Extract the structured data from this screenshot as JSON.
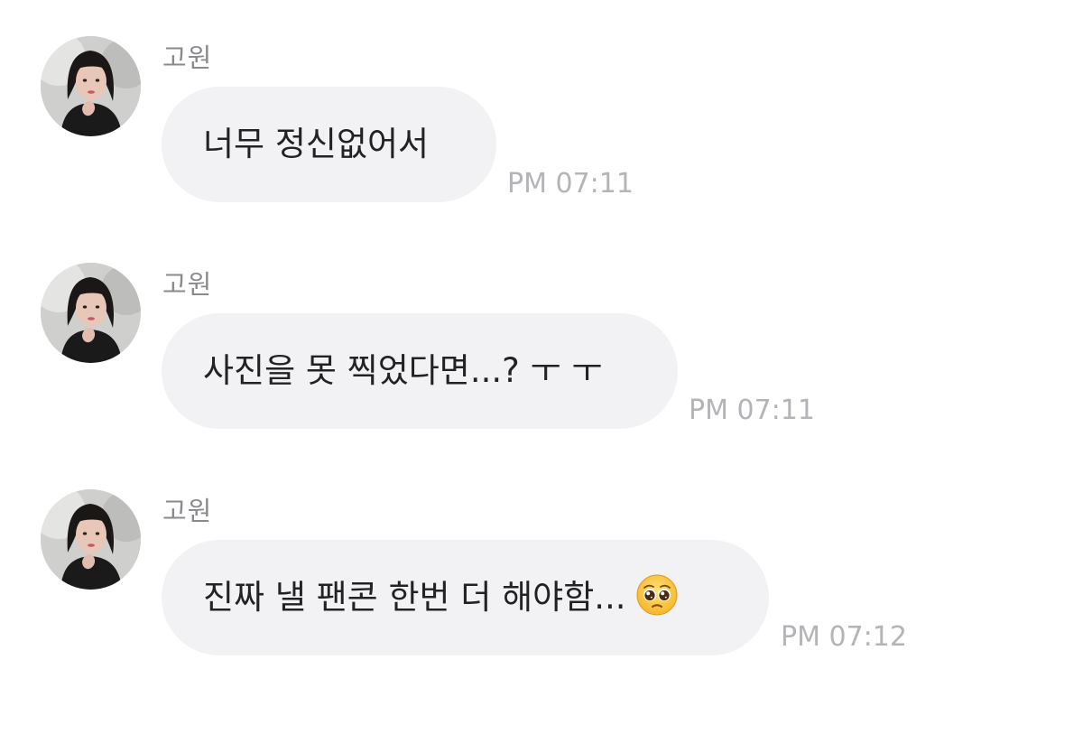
{
  "chat": {
    "messages": [
      {
        "sender": "고원",
        "avatar_icon": "profile-photo-avatar",
        "text": "너무 정신없어서",
        "emoji": null,
        "time": "PM 07:11"
      },
      {
        "sender": "고원",
        "avatar_icon": "profile-photo-avatar",
        "text": "사진을 못 찍었다면...? ㅜ ㅜ",
        "emoji": null,
        "time": "PM 07:11"
      },
      {
        "sender": "고원",
        "avatar_icon": "profile-photo-avatar",
        "text": "진짜 낼 팬콘 한번 더 해야함...",
        "emoji": "pleading-face-emoji",
        "time": "PM 07:12"
      }
    ]
  },
  "colors": {
    "bubble_bg": "#f2f2f4",
    "message_text": "#222226",
    "sender_name": "#8a8a8e",
    "timestamp": "#b4b4b8"
  }
}
